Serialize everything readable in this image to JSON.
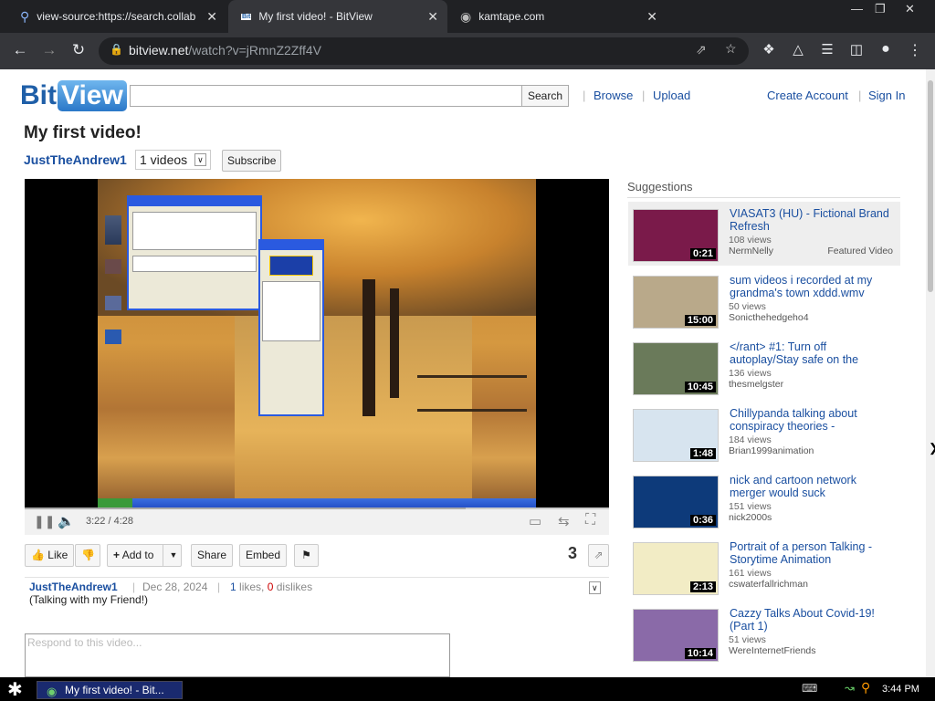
{
  "browser": {
    "tabs": [
      {
        "title": "view-source:https://search.collabn",
        "icon": "search-icon"
      },
      {
        "title": "My first video! - BitView",
        "icon": "bitview-icon"
      },
      {
        "title": "kamtape.com",
        "icon": "globe-icon"
      }
    ],
    "url_host": "bitview.net",
    "url_path": "/watch?v=jRmnZ2Zff4V"
  },
  "site": {
    "logo_bit": "Bit",
    "logo_view": "View",
    "search_button": "Search",
    "nav": {
      "browse": "Browse",
      "upload": "Upload",
      "create_account": "Create Account",
      "sign_in": "Sign In"
    }
  },
  "video": {
    "title": "My first video!",
    "uploader": "JustTheAndrew1",
    "video_count": "1 videos",
    "subscribe": "Subscribe",
    "time_current": "3:22",
    "time_total": "4:28",
    "time_sep": " / ",
    "progress": 0.755,
    "actions": {
      "like": "Like",
      "add_to": "Add to",
      "share": "Share",
      "embed": "Embed"
    },
    "view_count": "3",
    "date": "Dec 28, 2024",
    "likes": "1",
    "likes_label": " likes, ",
    "dislikes": "0",
    "dislikes_label": " dislikes",
    "description": "(Talking with my Friend!)",
    "comment_placeholder": "Respond to this video..."
  },
  "suggestions": {
    "heading": "Suggestions",
    "items": [
      {
        "title": "VIASAT3 (HU) - Fictional Brand Refresh",
        "views": "108 views",
        "author": "NermNelly",
        "duration": "0:21",
        "tag": "Featured Video",
        "thumb_color": "#7a1a4a"
      },
      {
        "title": "sum videos i recorded at my grandma's town xddd.wmv",
        "views": "50 views",
        "author": "Sonicthehedgeho4",
        "duration": "15:00",
        "thumb_color": "#b9a98a"
      },
      {
        "title": "</rant> #1: Turn off autoplay/Stay safe on the",
        "views": "136 views",
        "author": "thesmelgster",
        "duration": "10:45",
        "thumb_color": "#6a7a5a"
      },
      {
        "title": "Chillypanda talking about conspiracy theories -",
        "views": "184 views",
        "author": "Brian1999animation",
        "duration": "1:48",
        "thumb_color": "#d7e4ef"
      },
      {
        "title": "nick and cartoon network merger would suck",
        "views": "151 views",
        "author": "nick2000s",
        "duration": "0:36",
        "thumb_color": "#0d3a7a"
      },
      {
        "title": "Portrait of a person Talking - Storytime Animation",
        "views": "161 views",
        "author": "cswaterfallrichman",
        "duration": "2:13",
        "thumb_color": "#f2ecc5"
      },
      {
        "title": "Cazzy Talks About Covid-19! (Part 1)",
        "views": "51 views",
        "author": "WereInternetFriends",
        "duration": "10:14",
        "thumb_color": "#8a6aa8"
      }
    ]
  },
  "taskbar": {
    "window_title": "My first video! - Bit...",
    "clock": "3:44 PM"
  }
}
